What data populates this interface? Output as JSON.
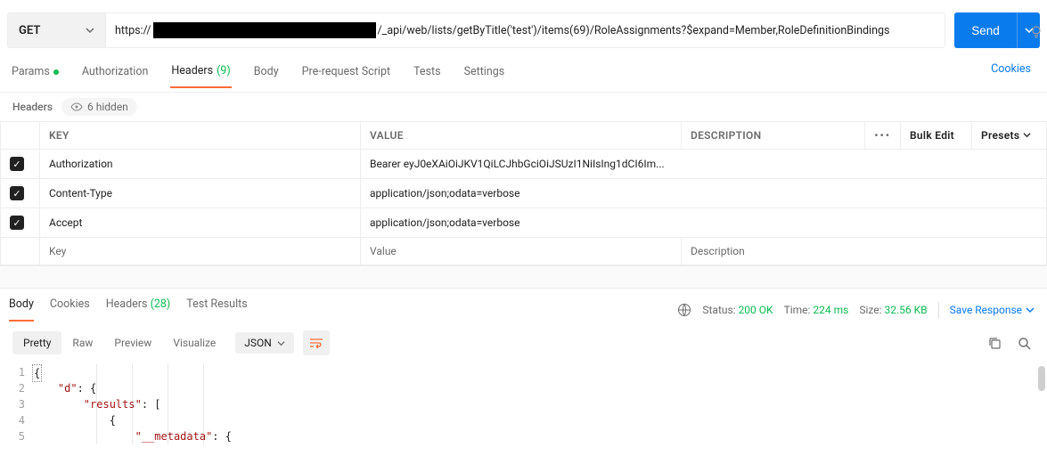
{
  "request": {
    "method": "GET",
    "url_prefix": "https://",
    "url_suffix": "/_api/web/lists/getByTitle('test')/items(69)/RoleAssignments?$expand=Member,RoleDefinitionBindings",
    "send_label": "Send"
  },
  "tabs": {
    "params": "Params",
    "authorization": "Authorization",
    "headers": "Headers",
    "headers_count": "(9)",
    "body": "Body",
    "prerequest": "Pre-request Script",
    "tests": "Tests",
    "settings": "Settings",
    "cookies": "Cookies"
  },
  "headers_section": {
    "label": "Headers",
    "hidden_text": "6 hidden",
    "columns": {
      "key": "KEY",
      "value": "VALUE",
      "description": "DESCRIPTION"
    },
    "bulk_edit": "Bulk Edit",
    "presets": "Presets",
    "rows": [
      {
        "checked": true,
        "key": "Authorization",
        "value": "Bearer eyJ0eXAiOiJKV1QiLCJhbGciOiJSUzI1NiIsIng1dCI6Im..."
      },
      {
        "checked": true,
        "key": "Content-Type",
        "value": "application/json;odata=verbose"
      },
      {
        "checked": true,
        "key": "Accept",
        "value": "application/json;odata=verbose"
      }
    ],
    "placeholders": {
      "key": "Key",
      "value": "Value",
      "description": "Description"
    }
  },
  "response": {
    "tabs": {
      "body": "Body",
      "cookies": "Cookies",
      "headers": "Headers",
      "headers_count": "(28)",
      "tests": "Test Results"
    },
    "status_label": "Status:",
    "status_value": "200 OK",
    "time_label": "Time:",
    "time_value": "224 ms",
    "size_label": "Size:",
    "size_value": "32.56 KB",
    "save": "Save Response",
    "views": {
      "pretty": "Pretty",
      "raw": "Raw",
      "preview": "Preview",
      "visualize": "Visualize"
    },
    "format": "JSON",
    "body_lines": [
      "{",
      "    \"d\": {",
      "        \"results\": [",
      "            {",
      "                \"__metadata\": {"
    ]
  },
  "colors": {
    "accent": "#ff6c37",
    "primary": "#097bed",
    "success": "#0cbb52"
  }
}
